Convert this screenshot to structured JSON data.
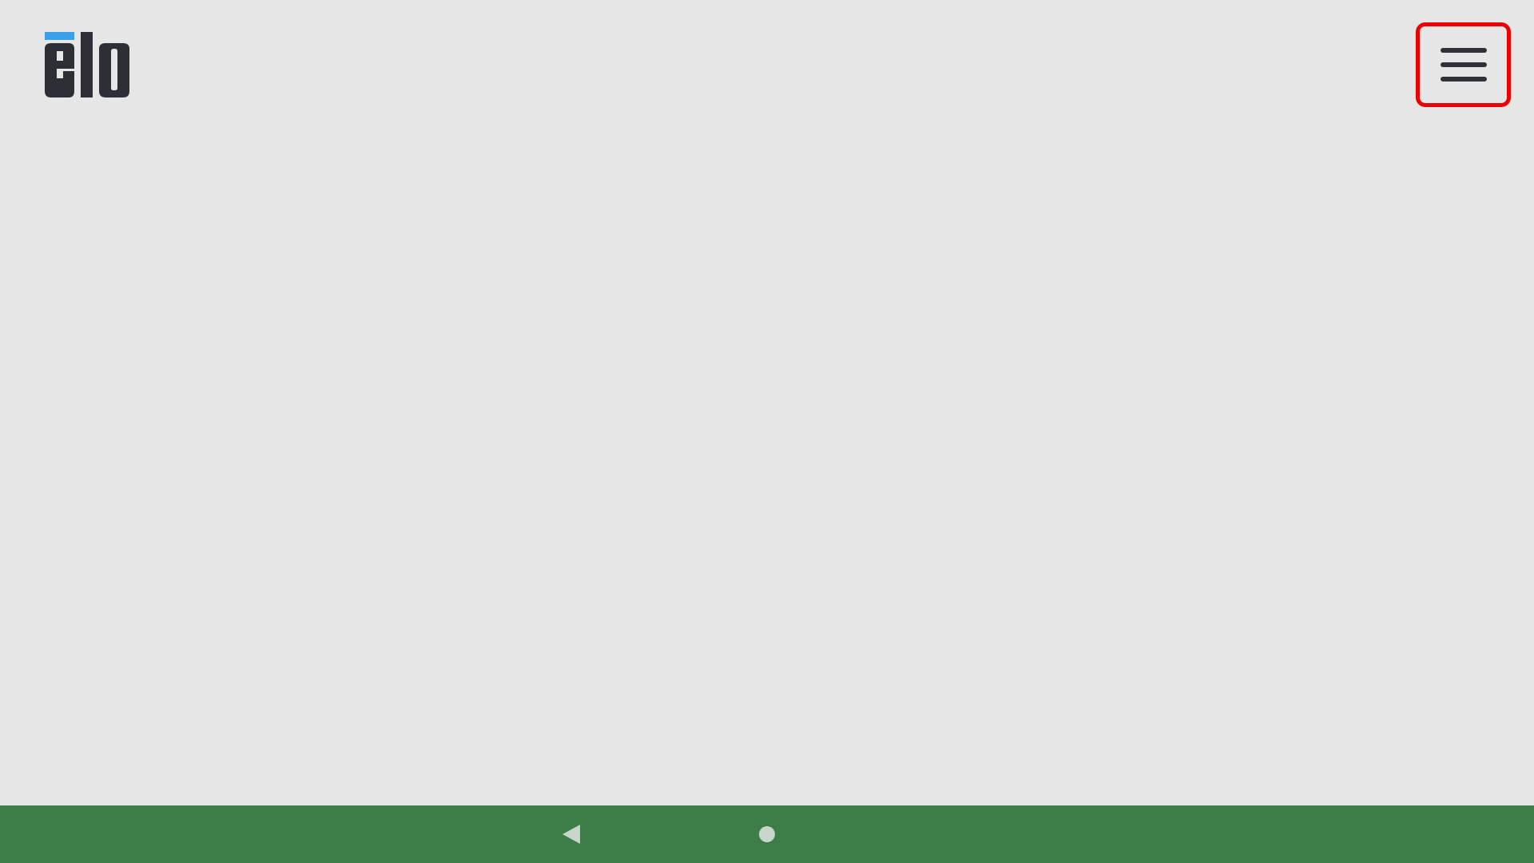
{
  "app": {
    "logo_text": "elo",
    "background_color": "#e6e6e6",
    "logo_colors": {
      "letters": "#2e2f36",
      "accent": "#3aa0ea"
    }
  },
  "header": {
    "menu_button": {
      "icon": "hamburger-menu-icon",
      "highlight_color": "#ee0000"
    }
  },
  "navigation_bar": {
    "color": "#3d7d47",
    "buttons": [
      {
        "name": "back",
        "icon": "back-triangle-icon"
      },
      {
        "name": "home",
        "icon": "home-circle-icon"
      }
    ]
  }
}
